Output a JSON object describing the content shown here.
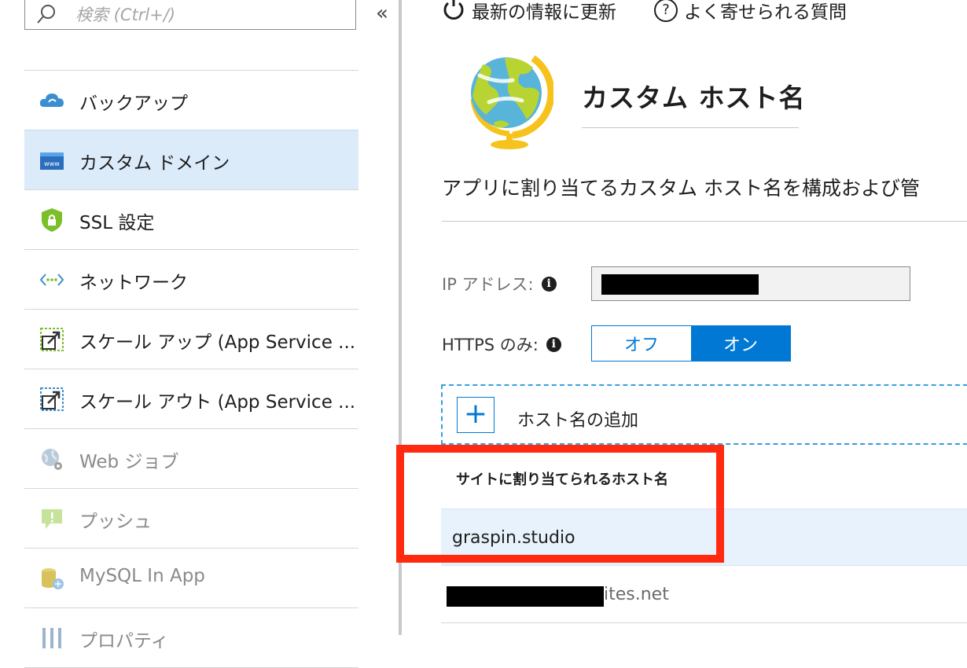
{
  "sidebar": {
    "search_placeholder": "検索 (Ctrl+/)",
    "collapse_glyph": "«",
    "items": [
      {
        "label": "バックアップ",
        "icon": "cloud-backup-icon"
      },
      {
        "label": "カスタム ドメイン",
        "icon": "www-icon",
        "selected": true
      },
      {
        "label": "SSL 設定",
        "icon": "shield-lock-icon"
      },
      {
        "label": "ネットワーク",
        "icon": "network-icon"
      },
      {
        "label": "スケール アップ (App Service ...",
        "icon": "scale-up-icon"
      },
      {
        "label": "スケール アウト (App Service ...",
        "icon": "scale-out-icon"
      },
      {
        "label": "Web ジョブ",
        "icon": "webjobs-icon",
        "disabled": true
      },
      {
        "label": "プッシュ",
        "icon": "push-icon",
        "disabled": true
      },
      {
        "label": "MySQL In App",
        "icon": "mysql-icon",
        "disabled": true
      },
      {
        "label": "プロパティ",
        "icon": "properties-icon",
        "disabled": true
      }
    ]
  },
  "toolbar": {
    "refresh_label": "最新の情報に更新",
    "faq_label": "よく寄せられる質問",
    "faq_glyph": "?"
  },
  "main": {
    "title": "カスタム ホスト名",
    "description": "アプリに割り当てるカスタム ホスト名を構成および管",
    "ip_label": "IP アドレス:",
    "https_label": "HTTPS のみ:",
    "info_glyph": "i",
    "toggle": {
      "off_label": "オフ",
      "on_label": "オン",
      "selected": "オン"
    },
    "add_host_glyph": "+",
    "add_host_label": "ホスト名の追加",
    "table_header": "サイトに割り当てられるホスト名",
    "rows": [
      {
        "hostname": "graspin.studio"
      },
      {
        "hostname_suffix": "ites.net"
      }
    ]
  },
  "colors": {
    "accent": "#0078d4",
    "selected_bg": "#dcebfa",
    "highlight_box": "#ff2a10"
  }
}
